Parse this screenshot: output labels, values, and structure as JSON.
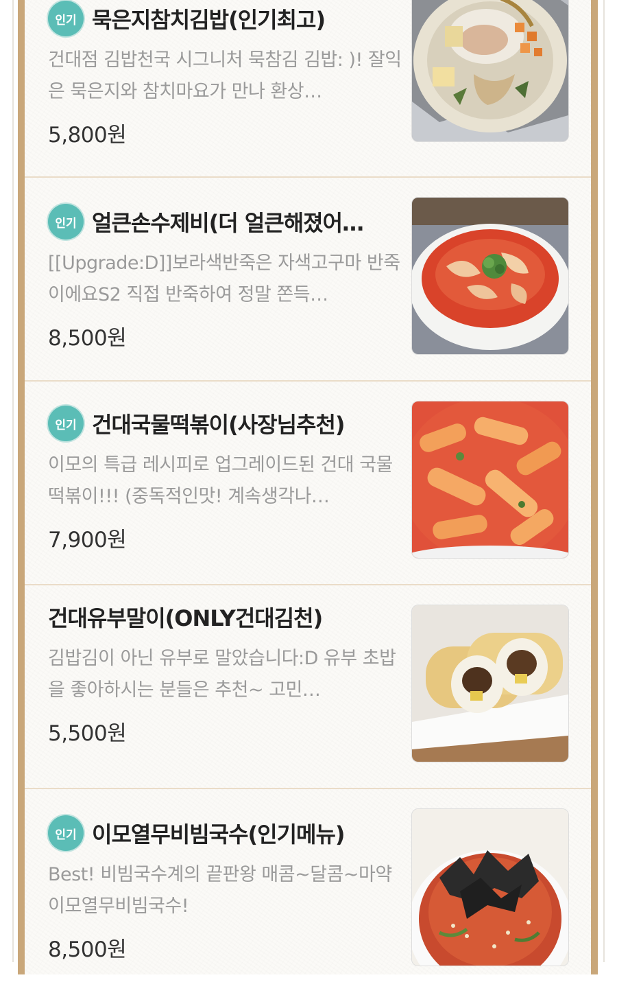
{
  "menu": {
    "items": [
      {
        "badge": "인기",
        "name": "묵은지참치김밥(인기최고)",
        "description": "건대점 김밥천국 시그니처 묵참김 김밥: )! 잘익은 묵은지와 참치마요가 만나 환상…",
        "price": "5,800원",
        "image": "kimbap-photo"
      },
      {
        "badge": "인기",
        "name": "얼큰손수제비(더 얼큰해졌어…",
        "description": "[[Upgrade:D]]보라색반죽은 자색고구마 반죽이에요S2 직접 반죽하여 정말 쫀득…",
        "price": "8,500원",
        "image": "sujebi-photo"
      },
      {
        "badge": "인기",
        "name": "건대국물떡볶이(사장님추천)",
        "description": "이모의 특급 레시피로 업그레이드된 건대 국물떡볶이!!! (중독적인맛! 계속생각나…",
        "price": "7,900원",
        "image": "tteokbokki-photo"
      },
      {
        "badge": "",
        "name": "건대유부말이(ONLY건대김천)",
        "description": "김밥김이 아닌 유부로 말았습니다:D  유부 초밥을 좋아하시는 분들은 추천~ 고민…",
        "price": "5,500원",
        "image": "yubu-roll-photo"
      },
      {
        "badge": "인기",
        "name": "이모열무비빔국수(인기메뉴)",
        "description": "Best! 비빔국수계의 끝판왕 매콤~달콤~마약 이모열무비빔국수!",
        "price": "8,500원",
        "image": "bibim-noodle-photo"
      }
    ]
  }
}
